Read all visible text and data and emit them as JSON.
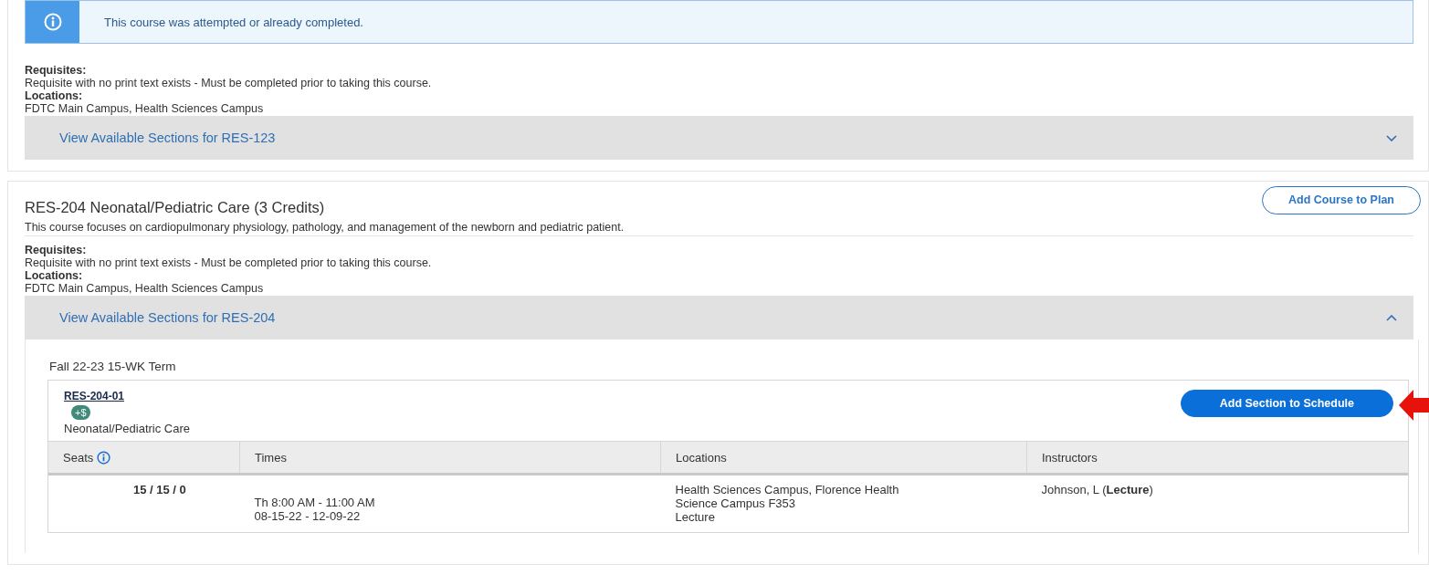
{
  "courses": [
    {
      "notice": "This course was attempted or already completed.",
      "requisites_label": "Requisites:",
      "requisites": "Requisite with no print text exists - Must be completed prior to taking this course.",
      "locations_label": "Locations:",
      "locations": "FDTC Main Campus, Health Sciences Campus",
      "sections_toggle": {
        "label": "View Available Sections for RES-123",
        "expanded": false
      }
    },
    {
      "title": "RES-204 Neonatal/Pediatric Care (3 Credits)",
      "description": "This course focuses on cardiopulmonary physiology, pathology, and management of the newborn and pediatric patient.",
      "plan_button": "Add Course to Plan",
      "requisites_label": "Requisites:",
      "requisites": "Requisite with no print text exists - Must be completed prior to taking this course.",
      "locations_label": "Locations:",
      "locations": "FDTC Main Campus, Health Sciences Campus",
      "sections_toggle": {
        "label": "View Available Sections for RES-204",
        "expanded": true
      },
      "term": "Fall 22-23 15-WK Term",
      "sections": [
        {
          "code": "RES-204-01",
          "fee_badge": "+$",
          "name": "Neonatal/Pediatric Care",
          "add_button": "Add Section to Schedule",
          "highlighted": true,
          "columns": [
            "Seats",
            "Times",
            "Locations",
            "Instructors"
          ],
          "rows": [
            {
              "seats": "15 / 15 / 0",
              "times": [
                "Th 8:00 AM - 11:00 AM",
                "08-15-22 - 12-09-22"
              ],
              "locations": [
                "Health Sciences Campus, Florence Health",
                "Science Campus F353",
                "Lecture"
              ],
              "instructors": "Johnson, L (**Lecture**)"
            }
          ]
        }
      ]
    }
  ]
}
